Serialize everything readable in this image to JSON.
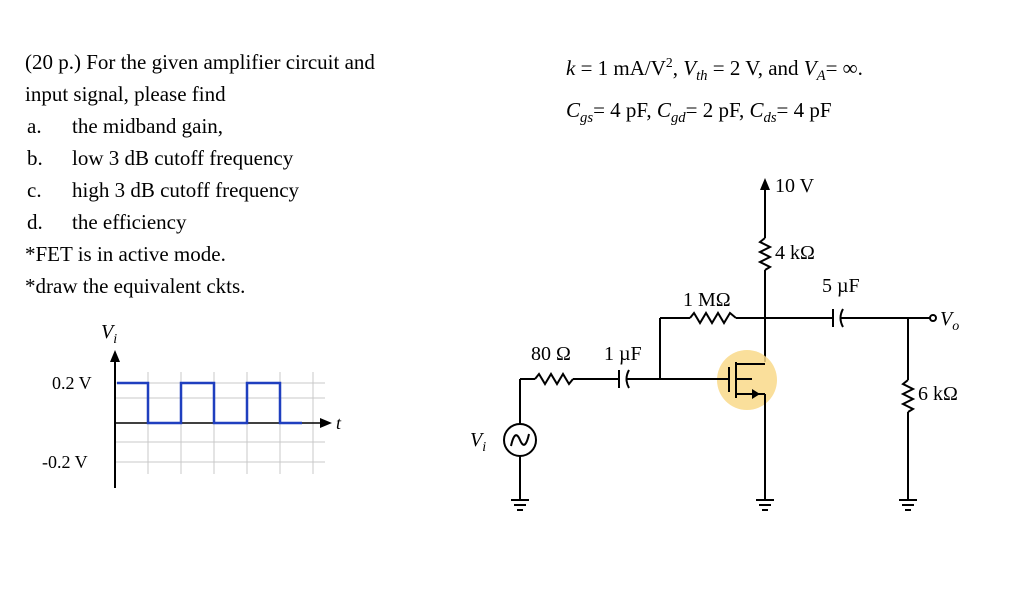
{
  "problem": {
    "header_points": "(20 p.)",
    "header_text": " For the given amplifier circuit and",
    "line2": "input signal, please find",
    "items": [
      {
        "marker": "a.",
        "text": "the midband gain,"
      },
      {
        "marker": "b.",
        "text": "low 3 dB cutoff frequency"
      },
      {
        "marker": "c.",
        "text": "high 3 dB cutoff frequency"
      },
      {
        "marker": "d.",
        "text": "the efficiency"
      }
    ],
    "notes": [
      "*FET is in active mode.",
      "*draw the equivalent ckts."
    ]
  },
  "parameters": {
    "k": "k = 1 mA/V²,",
    "vth_sym": "V",
    "vth_sub": "th",
    "vth_val": " = 2 V, and ",
    "va_sym": "V",
    "va_sub": "A",
    "va_val": "= ∞.",
    "cgs_sym": "C",
    "cgs_sub": "gs",
    "cgs_val": "= 4 pF, ",
    "cgd_sym": "C",
    "cgd_sub": "gd",
    "cgd_val": "= 2 pF, ",
    "cds_sym": "C",
    "cds_sub": "ds",
    "cds_val": "= 4 pF"
  },
  "waveform": {
    "ylabel_sym": "V",
    "ylabel_sub": "i",
    "xlabel": "t",
    "high_label": "0.2 V",
    "low_label": "-0.2 V",
    "high_value": 0.2,
    "low_value": -0.2,
    "color": "#1f3fbf"
  },
  "circuit": {
    "supply": "10 V",
    "rd": "4 kΩ",
    "rf": "1 MΩ",
    "cout": "5 µF",
    "vo_sym": "V",
    "vo_sub": "o",
    "rl": "6 kΩ",
    "rs": "80 Ω",
    "cin": "1 µF",
    "vi_sym": "V",
    "vi_sub": "i",
    "highlight_color": "#f9d98a"
  }
}
